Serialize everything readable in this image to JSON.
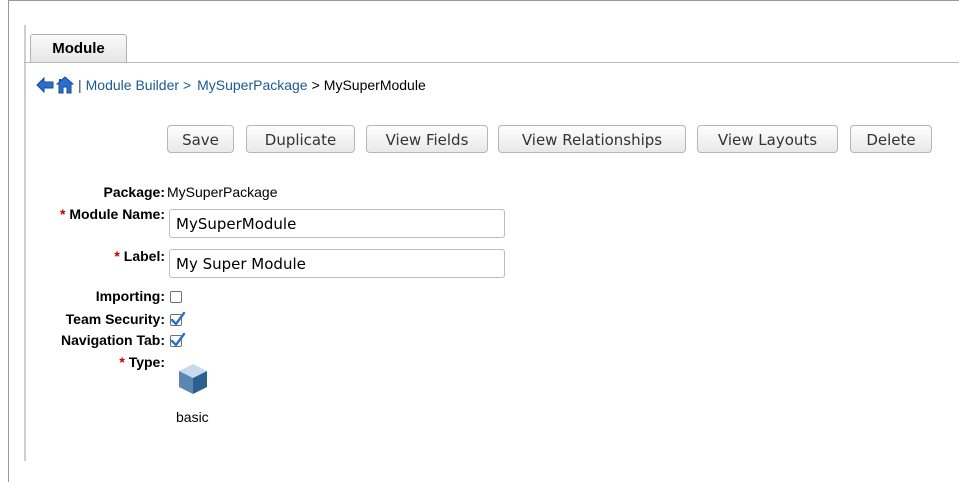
{
  "tab": {
    "label": "Module"
  },
  "breadcrumb": {
    "separator": "|",
    "module_builder": "Module Builder >",
    "package": "MySuperPackage",
    "arrow": ">",
    "module": "MySuperModule"
  },
  "toolbar": {
    "save": "Save",
    "duplicate": "Duplicate",
    "view_fields": "View Fields",
    "view_relationships": "View Relationships",
    "view_layouts": "View Layouts",
    "delete": "Delete"
  },
  "form": {
    "package_label": "Package:",
    "package_value": "MySuperPackage",
    "required_mark": "*",
    "module_name_label": "Module Name:",
    "module_name_value": "MySuperModule",
    "label_label": "Label:",
    "label_value": "My Super Module",
    "importing_label": "Importing:",
    "importing_checked": false,
    "team_security_label": "Team Security:",
    "team_security_checked": true,
    "navigation_tab_label": "Navigation Tab:",
    "navigation_tab_checked": true,
    "type_label": "Type:",
    "type_value": "basic"
  },
  "colors": {
    "link": "#1c5a93",
    "required": "#c00000",
    "check": "#2a6fd0"
  }
}
